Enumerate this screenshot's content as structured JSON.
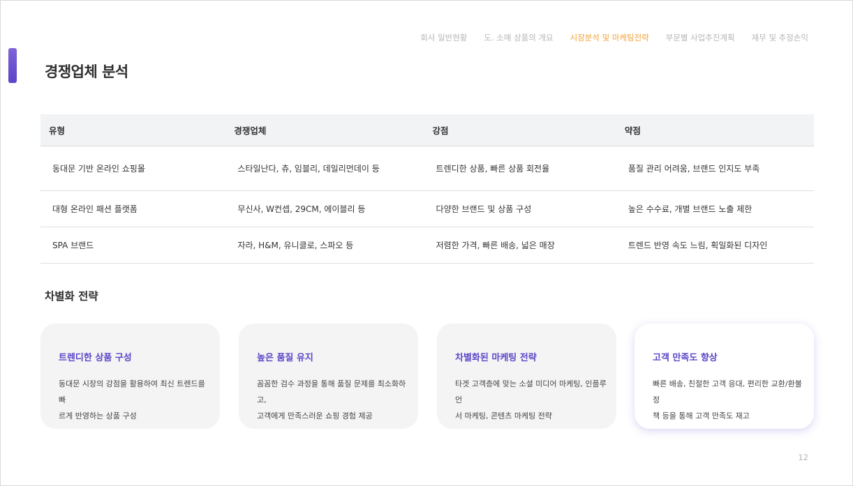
{
  "nav": {
    "items": [
      {
        "label": "회사 일반현황",
        "active": false
      },
      {
        "label": "도. 소매 상품의 개요",
        "active": false
      },
      {
        "label": "시장분석 및 마케팅전략",
        "active": true
      },
      {
        "label": "부문별 사업추진계획",
        "active": false
      },
      {
        "label": "재무 및 추정손익",
        "active": false
      }
    ],
    "active_color": "#f0a23a"
  },
  "page": {
    "title": "경쟁업체 분석",
    "accent_color": "#6a52cf",
    "number": "12"
  },
  "table": {
    "headers": [
      "유형",
      "경쟁업체",
      "강점",
      "약점"
    ],
    "rows": [
      [
        "동대문 기반 온라인 쇼핑몰",
        "스타일난다, 츄, 임블리, 데일리먼데이 등",
        "트렌디한 상품, 빠른 상품 회전율",
        "품질 관리 어려움, 브랜드 인지도 부족"
      ],
      [
        "대형 온라인 패션 플랫폼",
        "무신사, W컨셉, 29CM, 에이블리 등",
        "다양한 브랜드 및 상품 구성",
        "높은 수수료, 개별 브랜드 노출 제한"
      ],
      [
        "SPA 브랜드",
        "자라, H&M, 유니클로, 스파오 등",
        "저렴한 가격, 빠른 배송, 넓은 매장",
        "트렌드 반영 속도 느림, 획일화된 디자인"
      ]
    ]
  },
  "strategy": {
    "title": "차별화 전략",
    "cards": [
      {
        "title": "트렌디한 상품 구성",
        "line1": "동대문 시장의 강점을 활용하여 최신 트렌드를 빠",
        "line2": "르게 반영하는 상품 구성",
        "highlight": false
      },
      {
        "title": "높은 품질 유지",
        "line1": "꼼꼼한 검수 과정을 통해 품질 문제를 최소화하고,",
        "line2": "고객에게 만족스러운 쇼핑 경험 제공",
        "highlight": false
      },
      {
        "title": "차별화된 마케팅 전략",
        "line1": "타겟 고객층에 맞는 소셜 미디어 마케팅, 인플루언",
        "line2": "서 마케팅, 콘텐츠 마케팅 전략",
        "highlight": false
      },
      {
        "title": "고객 만족도 향상",
        "line1": "빠른 배송, 친절한 고객 응대, 편리한 교환/환불 정",
        "line2": "책 등을 통해 고객 만족도 재고",
        "highlight": true
      }
    ]
  }
}
